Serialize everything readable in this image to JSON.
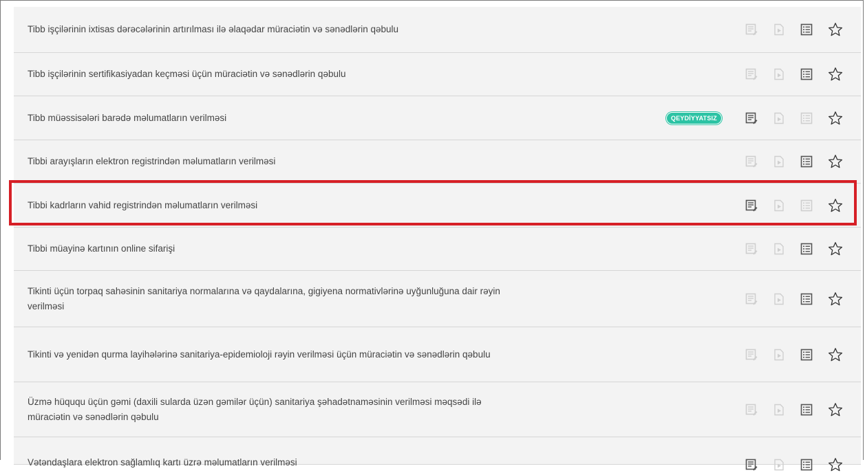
{
  "services": [
    {
      "title": "Tibb işçilərinin ixtisas dərəcələrinin artırılması ilə əlaqədar müraciətin və sənədlərin qəbulu",
      "badge": null,
      "active": [
        false,
        false,
        true
      ],
      "star": "☆"
    },
    {
      "title": "Tibb işçilərinin sertifikasiyadan keçməsi üçün müraciətin və sənədlərin qəbulu",
      "badge": null,
      "active": [
        false,
        false,
        true
      ],
      "star": "☆"
    },
    {
      "title": "Tibb müəssisələri barədə məlumatların verilməsi",
      "badge": "QEYDİYYATSIZ",
      "active": [
        true,
        false,
        false
      ],
      "star": "☆"
    },
    {
      "title": "Tibbi arayışların elektron registrindən məlumatların verilməsi",
      "badge": null,
      "active": [
        false,
        false,
        true
      ],
      "star": "☆"
    },
    {
      "title": "Tibbi kadrların vahid registrindən məlumatların verilməsi",
      "badge": null,
      "active": [
        true,
        false,
        false
      ],
      "star": "☆",
      "highlighted": true
    },
    {
      "title": "Tibbi müayinə kartının online sifarişi",
      "badge": null,
      "active": [
        false,
        false,
        true
      ],
      "star": "☆"
    },
    {
      "title": "Tikinti üçün torpaq sahəsinin sanitariya normalarına və qaydalarına, gigiyena normativlərinə uyğunluğuna dair rəyin verilməsi",
      "badge": null,
      "active": [
        false,
        false,
        true
      ],
      "star": "☆"
    },
    {
      "title": "Tikinti və yenidən qurma layihələrinə sanitariya-epidemioloji rəyin verilməsi üçün müraciətin və sənədlərin qəbulu",
      "badge": null,
      "active": [
        false,
        false,
        true
      ],
      "star": "☆"
    },
    {
      "title": "Üzmə hüququ üçün gəmi (daxili sularda üzən gəmilər üçün) sanitariya şəhadətnaməsinin verilməsi məqsədi ilə müraciətin və sənədlərin qəbulu",
      "badge": null,
      "active": [
        false,
        false,
        true
      ],
      "star": "☆"
    },
    {
      "title": "Vətəndaşlara elektron sağlamlıq kartı üzrə məlumatların verilməsi",
      "badge": null,
      "active": [
        true,
        false,
        true
      ],
      "star": "☆",
      "clipped": true
    }
  ],
  "colors": {
    "icon_active": "#555555",
    "icon_inactive": "#cfcfcf",
    "badge": "#2cc3a4",
    "highlight": "#d61f26"
  },
  "icon_names": [
    "form-edit-icon",
    "video-guide-icon",
    "document-list-icon",
    "favorite-star-icon"
  ]
}
